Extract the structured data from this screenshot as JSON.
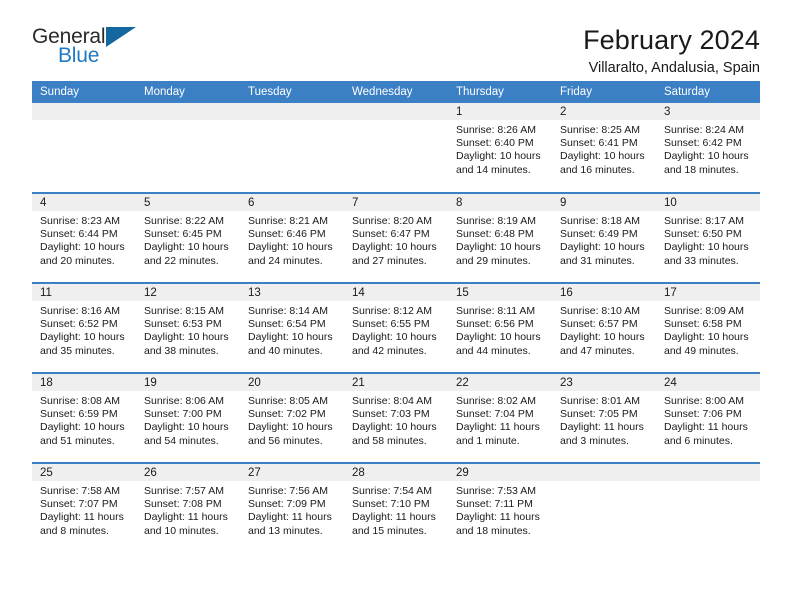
{
  "brand": {
    "name_top": "General",
    "name_bottom": "Blue",
    "triangle_color": "#15679f",
    "blue_color": "#1f7ac4"
  },
  "header": {
    "title": "February 2024",
    "subtitle": "Villaralto, Andalusia, Spain"
  },
  "colors": {
    "header_bar": "#3b7fc4",
    "daynum_band": "#efefef",
    "week_divider": "#3b7fc4",
    "text": "#1a1a1a"
  },
  "weekday_headers": [
    "Sunday",
    "Monday",
    "Tuesday",
    "Wednesday",
    "Thursday",
    "Friday",
    "Saturday"
  ],
  "weeks": [
    [
      {
        "day": "",
        "empty": true,
        "sunrise": "",
        "sunset": "",
        "daylight": ""
      },
      {
        "day": "",
        "empty": true,
        "sunrise": "",
        "sunset": "",
        "daylight": ""
      },
      {
        "day": "",
        "empty": true,
        "sunrise": "",
        "sunset": "",
        "daylight": ""
      },
      {
        "day": "",
        "empty": true,
        "sunrise": "",
        "sunset": "",
        "daylight": ""
      },
      {
        "day": "1",
        "empty": false,
        "sunrise": "Sunrise: 8:26 AM",
        "sunset": "Sunset: 6:40 PM",
        "daylight": "Daylight: 10 hours and 14 minutes."
      },
      {
        "day": "2",
        "empty": false,
        "sunrise": "Sunrise: 8:25 AM",
        "sunset": "Sunset: 6:41 PM",
        "daylight": "Daylight: 10 hours and 16 minutes."
      },
      {
        "day": "3",
        "empty": false,
        "sunrise": "Sunrise: 8:24 AM",
        "sunset": "Sunset: 6:42 PM",
        "daylight": "Daylight: 10 hours and 18 minutes."
      }
    ],
    [
      {
        "day": "4",
        "empty": false,
        "sunrise": "Sunrise: 8:23 AM",
        "sunset": "Sunset: 6:44 PM",
        "daylight": "Daylight: 10 hours and 20 minutes."
      },
      {
        "day": "5",
        "empty": false,
        "sunrise": "Sunrise: 8:22 AM",
        "sunset": "Sunset: 6:45 PM",
        "daylight": "Daylight: 10 hours and 22 minutes."
      },
      {
        "day": "6",
        "empty": false,
        "sunrise": "Sunrise: 8:21 AM",
        "sunset": "Sunset: 6:46 PM",
        "daylight": "Daylight: 10 hours and 24 minutes."
      },
      {
        "day": "7",
        "empty": false,
        "sunrise": "Sunrise: 8:20 AM",
        "sunset": "Sunset: 6:47 PM",
        "daylight": "Daylight: 10 hours and 27 minutes."
      },
      {
        "day": "8",
        "empty": false,
        "sunrise": "Sunrise: 8:19 AM",
        "sunset": "Sunset: 6:48 PM",
        "daylight": "Daylight: 10 hours and 29 minutes."
      },
      {
        "day": "9",
        "empty": false,
        "sunrise": "Sunrise: 8:18 AM",
        "sunset": "Sunset: 6:49 PM",
        "daylight": "Daylight: 10 hours and 31 minutes."
      },
      {
        "day": "10",
        "empty": false,
        "sunrise": "Sunrise: 8:17 AM",
        "sunset": "Sunset: 6:50 PM",
        "daylight": "Daylight: 10 hours and 33 minutes."
      }
    ],
    [
      {
        "day": "11",
        "empty": false,
        "sunrise": "Sunrise: 8:16 AM",
        "sunset": "Sunset: 6:52 PM",
        "daylight": "Daylight: 10 hours and 35 minutes."
      },
      {
        "day": "12",
        "empty": false,
        "sunrise": "Sunrise: 8:15 AM",
        "sunset": "Sunset: 6:53 PM",
        "daylight": "Daylight: 10 hours and 38 minutes."
      },
      {
        "day": "13",
        "empty": false,
        "sunrise": "Sunrise: 8:14 AM",
        "sunset": "Sunset: 6:54 PM",
        "daylight": "Daylight: 10 hours and 40 minutes."
      },
      {
        "day": "14",
        "empty": false,
        "sunrise": "Sunrise: 8:12 AM",
        "sunset": "Sunset: 6:55 PM",
        "daylight": "Daylight: 10 hours and 42 minutes."
      },
      {
        "day": "15",
        "empty": false,
        "sunrise": "Sunrise: 8:11 AM",
        "sunset": "Sunset: 6:56 PM",
        "daylight": "Daylight: 10 hours and 44 minutes."
      },
      {
        "day": "16",
        "empty": false,
        "sunrise": "Sunrise: 8:10 AM",
        "sunset": "Sunset: 6:57 PM",
        "daylight": "Daylight: 10 hours and 47 minutes."
      },
      {
        "day": "17",
        "empty": false,
        "sunrise": "Sunrise: 8:09 AM",
        "sunset": "Sunset: 6:58 PM",
        "daylight": "Daylight: 10 hours and 49 minutes."
      }
    ],
    [
      {
        "day": "18",
        "empty": false,
        "sunrise": "Sunrise: 8:08 AM",
        "sunset": "Sunset: 6:59 PM",
        "daylight": "Daylight: 10 hours and 51 minutes."
      },
      {
        "day": "19",
        "empty": false,
        "sunrise": "Sunrise: 8:06 AM",
        "sunset": "Sunset: 7:00 PM",
        "daylight": "Daylight: 10 hours and 54 minutes."
      },
      {
        "day": "20",
        "empty": false,
        "sunrise": "Sunrise: 8:05 AM",
        "sunset": "Sunset: 7:02 PM",
        "daylight": "Daylight: 10 hours and 56 minutes."
      },
      {
        "day": "21",
        "empty": false,
        "sunrise": "Sunrise: 8:04 AM",
        "sunset": "Sunset: 7:03 PM",
        "daylight": "Daylight: 10 hours and 58 minutes."
      },
      {
        "day": "22",
        "empty": false,
        "sunrise": "Sunrise: 8:02 AM",
        "sunset": "Sunset: 7:04 PM",
        "daylight": "Daylight: 11 hours and 1 minute."
      },
      {
        "day": "23",
        "empty": false,
        "sunrise": "Sunrise: 8:01 AM",
        "sunset": "Sunset: 7:05 PM",
        "daylight": "Daylight: 11 hours and 3 minutes."
      },
      {
        "day": "24",
        "empty": false,
        "sunrise": "Sunrise: 8:00 AM",
        "sunset": "Sunset: 7:06 PM",
        "daylight": "Daylight: 11 hours and 6 minutes."
      }
    ],
    [
      {
        "day": "25",
        "empty": false,
        "sunrise": "Sunrise: 7:58 AM",
        "sunset": "Sunset: 7:07 PM",
        "daylight": "Daylight: 11 hours and 8 minutes."
      },
      {
        "day": "26",
        "empty": false,
        "sunrise": "Sunrise: 7:57 AM",
        "sunset": "Sunset: 7:08 PM",
        "daylight": "Daylight: 11 hours and 10 minutes."
      },
      {
        "day": "27",
        "empty": false,
        "sunrise": "Sunrise: 7:56 AM",
        "sunset": "Sunset: 7:09 PM",
        "daylight": "Daylight: 11 hours and 13 minutes."
      },
      {
        "day": "28",
        "empty": false,
        "sunrise": "Sunrise: 7:54 AM",
        "sunset": "Sunset: 7:10 PM",
        "daylight": "Daylight: 11 hours and 15 minutes."
      },
      {
        "day": "29",
        "empty": false,
        "sunrise": "Sunrise: 7:53 AM",
        "sunset": "Sunset: 7:11 PM",
        "daylight": "Daylight: 11 hours and 18 minutes."
      },
      {
        "day": "",
        "empty": true,
        "sunrise": "",
        "sunset": "",
        "daylight": ""
      },
      {
        "day": "",
        "empty": true,
        "sunrise": "",
        "sunset": "",
        "daylight": ""
      }
    ]
  ]
}
